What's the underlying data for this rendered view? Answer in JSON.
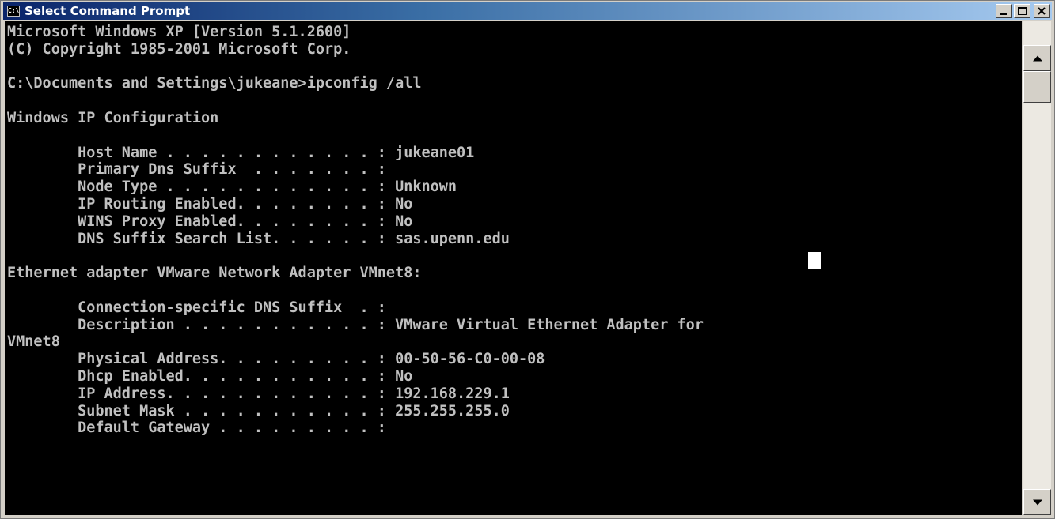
{
  "window": {
    "title": "Select Command Prompt",
    "icon_label": "C:\\"
  },
  "console": {
    "lines": [
      "Microsoft Windows XP [Version 5.1.2600]",
      "(C) Copyright 1985-2001 Microsoft Corp.",
      "",
      "C:\\Documents and Settings\\jukeane>ipconfig /all",
      "",
      "Windows IP Configuration",
      "",
      "        Host Name . . . . . . . . . . . . : jukeane01",
      "        Primary Dns Suffix  . . . . . . . :",
      "        Node Type . . . . . . . . . . . . : Unknown",
      "        IP Routing Enabled. . . . . . . . : No",
      "        WINS Proxy Enabled. . . . . . . . : No",
      "        DNS Suffix Search List. . . . . . : sas.upenn.edu",
      "",
      "Ethernet adapter VMware Network Adapter VMnet8:",
      "",
      "        Connection-specific DNS Suffix  . :",
      "        Description . . . . . . . . . . . : VMware Virtual Ethernet Adapter for",
      "VMnet8",
      "        Physical Address. . . . . . . . . : 00-50-56-C0-00-08",
      "        Dhcp Enabled. . . . . . . . . . . : No",
      "        IP Address. . . . . . . . . . . . : 192.168.229.1",
      "        Subnet Mask . . . . . . . . . . . : 255.255.255.0",
      "        Default Gateway . . . . . . . . . :"
    ]
  },
  "colors": {
    "console_background": "#000000",
    "console_text": "#c0c0c0",
    "titlebar_start": "#0a246a",
    "titlebar_end": "#a6caf0"
  },
  "icons": {
    "minimize": "minimize-icon",
    "maximize": "maximize-icon",
    "close": "close-icon",
    "scroll_up": "arrow-up-icon",
    "scroll_down": "arrow-down-icon"
  }
}
